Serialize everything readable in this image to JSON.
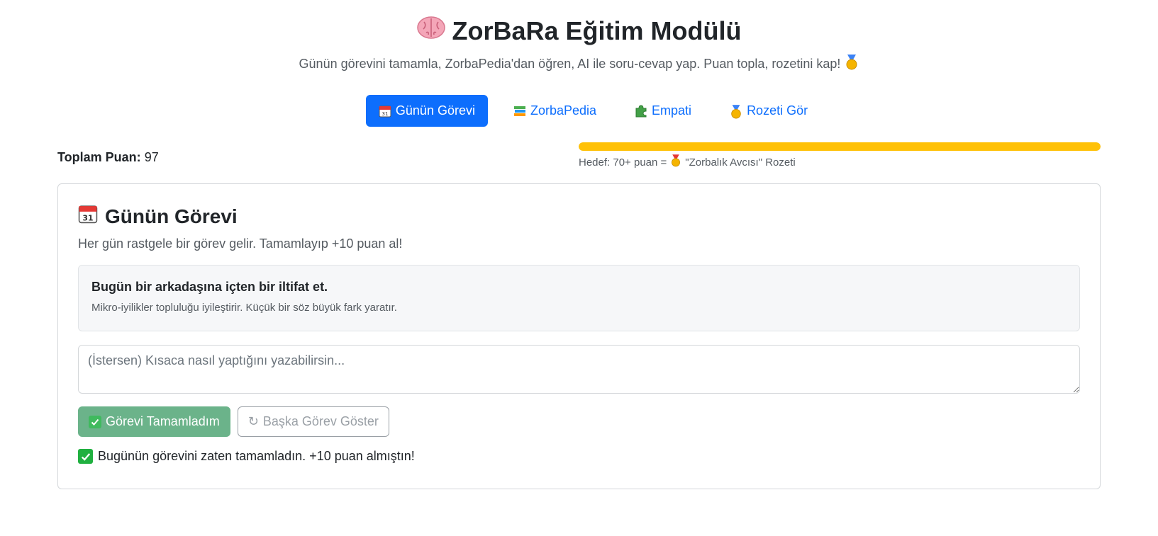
{
  "header": {
    "title": "ZorBaRa Eğitim Modülü",
    "title_icon": "brain-icon",
    "subtitle": "Günün görevini tamamla, ZorbaPedia'dan öğren, AI ile soru-cevap yap. Puan topla, rozetini kap!",
    "subtitle_icon": "medal-icon"
  },
  "tabs": [
    {
      "label": "Günün Görevi",
      "icon": "calendar-icon",
      "active": true
    },
    {
      "label": "ZorbaPedia",
      "icon": "books-icon",
      "active": false
    },
    {
      "label": "Empati",
      "icon": "puzzle-icon",
      "active": false
    },
    {
      "label": "Rozeti Gör",
      "icon": "medal-icon",
      "active": false
    }
  ],
  "stats": {
    "total_label": "Toplam Puan:",
    "total_value": "97",
    "progress_percent": 100,
    "progress_color": "#ffc107",
    "goal_prefix": "Hedef: 70+ puan =",
    "goal_badge": "\"Zorbalık Avcısı\" Rozeti"
  },
  "card": {
    "title": "Günün Görevi",
    "description": "Her gün rastgele bir görev gelir. Tamamlayıp +10 puan al!",
    "task_title": "Bugün bir arkadaşına içten bir iltifat et.",
    "task_subtitle": "Mikro-iyilikler topluluğu iyileştirir. Küçük bir söz büyük fark yaratır.",
    "note_placeholder": "(İstersen) Kısaca nasıl yaptığını yazabilirsin...",
    "note_value": "",
    "complete_button": "Görevi Tamamladım",
    "other_button": "Başka Görev Göster",
    "other_button_icon": "↻",
    "status_text": "Bugünün görevini zaten tamamladın. +10 puan almıştın!"
  },
  "colors": {
    "primary": "#0d6efd",
    "success": "#6bb38a",
    "warning": "#ffc107"
  }
}
